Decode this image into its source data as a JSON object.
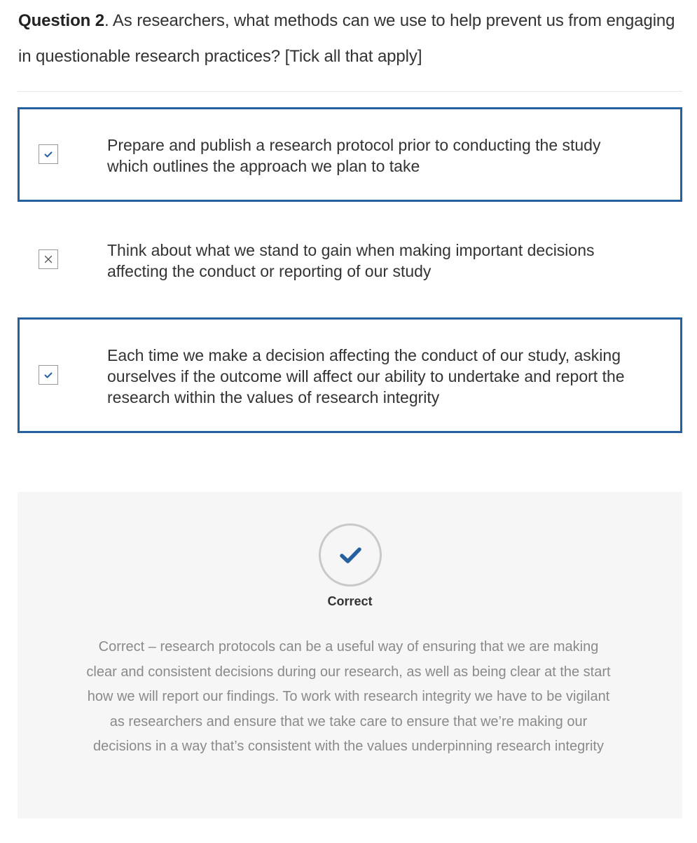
{
  "question": {
    "number_label": "Question 2",
    "text": ". As researchers, what methods can we use to help prevent us from engaging in questionable research practices? [Tick all that apply]"
  },
  "options": [
    {
      "text": "Prepare and publish a research protocol prior to conducting the study which outlines the approach we plan to take",
      "selected": true,
      "mark": "check"
    },
    {
      "text": "Think about what we stand to gain when making important decisions affecting the conduct or reporting of our study",
      "selected": false,
      "mark": "cross"
    },
    {
      "text": "Each time we make a decision affecting the conduct of our study, asking ourselves if the outcome will affect our ability to undertake and report the research within the values of research integrity",
      "selected": true,
      "mark": "check"
    }
  ],
  "feedback": {
    "icon": "checkmark-icon",
    "status": "Correct",
    "text": "Correct – research protocols can be a useful way of ensuring that we are making clear and consistent decisions during our research, as well as being clear at the start how we will report our findings. To work with research integrity we have to be vigilant as researchers and ensure that we take care to ensure that we’re making our decisions in a way that’s consistent with the values underpinning research integrity"
  },
  "colors": {
    "accent": "#27609f",
    "feedback_background": "#f6f6f6",
    "feedback_text": "#8a8a8a"
  }
}
